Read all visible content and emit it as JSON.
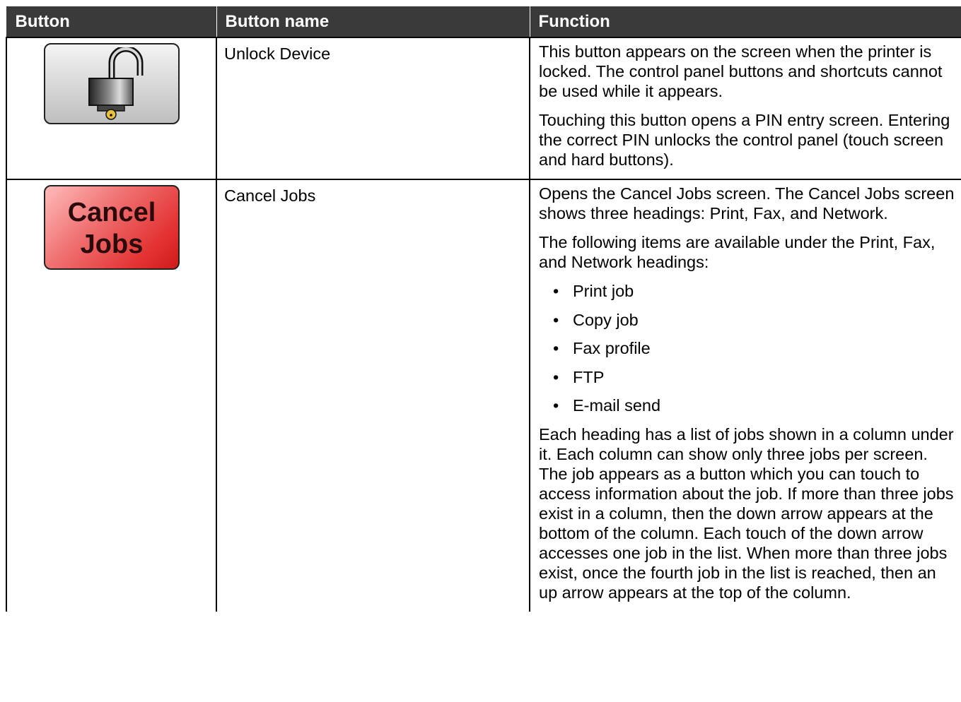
{
  "table": {
    "headers": [
      "Button",
      "Button name",
      "Function"
    ],
    "rows": [
      {
        "icon": "unlock-padlock-icon",
        "name": "Unlock Device",
        "function": [
          "This button appears on the screen when the printer is locked. The control panel buttons and shortcuts cannot be used while it appears.",
          "Touching this button opens a PIN entry screen. Entering the correct PIN unlocks the control panel (touch screen and hard buttons)."
        ]
      },
      {
        "icon_label": [
          "Cancel",
          "Jobs"
        ],
        "name": "Cancel Jobs",
        "function_intro": [
          "Opens the Cancel Jobs screen. The Cancel Jobs screen shows three headings: Print, Fax, and Network.",
          "The following items are available under the Print, Fax, and Network headings:"
        ],
        "function_items": [
          "Print job",
          "Copy job",
          "Fax profile",
          "FTP",
          "E-mail send"
        ],
        "function_outro": "Each heading has a list of jobs shown in a column under it. Each column can show only three jobs per screen. The job appears as a button which you can touch to access information about the job. If more than three jobs exist in a column, then the down arrow appears at the bottom of the column. Each touch of the down arrow accesses one job in the list. When more than three jobs exist, once the fourth job in the list is reached, then an up arrow appears at the top of the column."
      }
    ]
  },
  "colors": {
    "header_bg": "#3a3a3a",
    "cancel_button": "#e33030"
  }
}
